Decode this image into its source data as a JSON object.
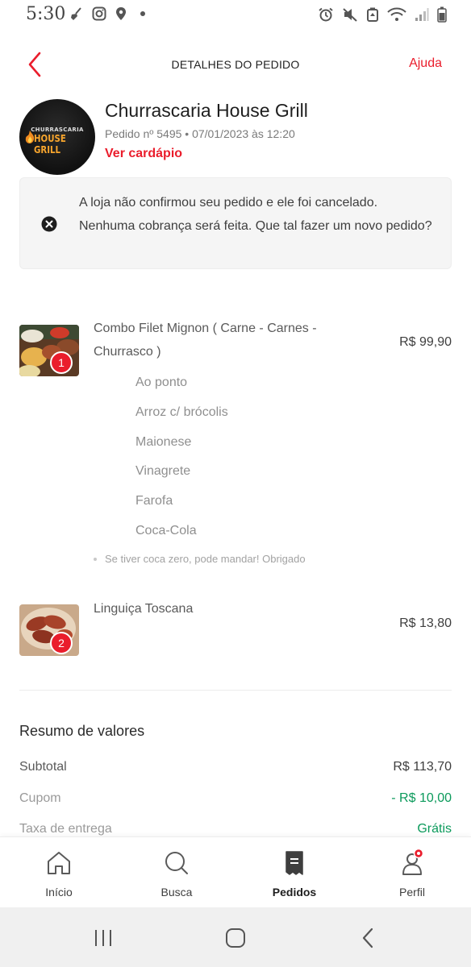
{
  "status_bar": {
    "time": "5:30",
    "left_icons": [
      "broom-icon",
      "instagram-icon",
      "location-pin-icon"
    ],
    "right_icons": [
      "alarm-icon",
      "mute-icon",
      "recycle-icon",
      "wifi-icon",
      "signal-icon",
      "battery-icon"
    ]
  },
  "header": {
    "title": "DETALHES DO PEDIDO",
    "help": "Ajuda"
  },
  "store": {
    "logo_line1": "CHURRASCARIA",
    "logo_line2": "HOUSE GRILL",
    "name": "Churrascaria House Grill",
    "order_meta": "Pedido nº 5495  • 07/01/2023 às 12:20",
    "menu_link": "Ver cardápio"
  },
  "notice": {
    "text": "A loja não confirmou seu pedido e ele foi cancelado. Nenhuma cobrança será feita. Que tal fazer um novo pedido?"
  },
  "items": [
    {
      "quantity": "1",
      "name": "Combo Filet Mignon ( Carne - Carnes - Churrasco )",
      "price": "R$ 99,90",
      "options": [
        "Ao ponto",
        "Arroz c/ brócolis",
        "Maionese",
        "Vinagrete",
        "Farofa",
        "Coca-Cola"
      ],
      "observation": "Se tiver coca zero, pode mandar! Obrigado"
    },
    {
      "quantity": "2",
      "name": "Linguiça Toscana",
      "price": "R$ 13,80"
    }
  ],
  "summary": {
    "title": "Resumo de valores",
    "subtotal_label": "Subtotal",
    "subtotal_value": "R$ 113,70",
    "coupon_label": "Cupom",
    "coupon_value": "- R$ 10,00",
    "delivery_label": "Taxa de entrega",
    "delivery_value": "Grátis"
  },
  "bottom_nav": {
    "items": [
      {
        "label": "Início",
        "icon": "home-icon"
      },
      {
        "label": "Busca",
        "icon": "search-icon"
      },
      {
        "label": "Pedidos",
        "icon": "orders-icon",
        "active": true
      },
      {
        "label": "Perfil",
        "icon": "profile-icon",
        "notification": true
      }
    ]
  },
  "colors": {
    "accent": "#ea1d2c",
    "success": "#0b9a5b",
    "muted": "#8f8f8f"
  }
}
